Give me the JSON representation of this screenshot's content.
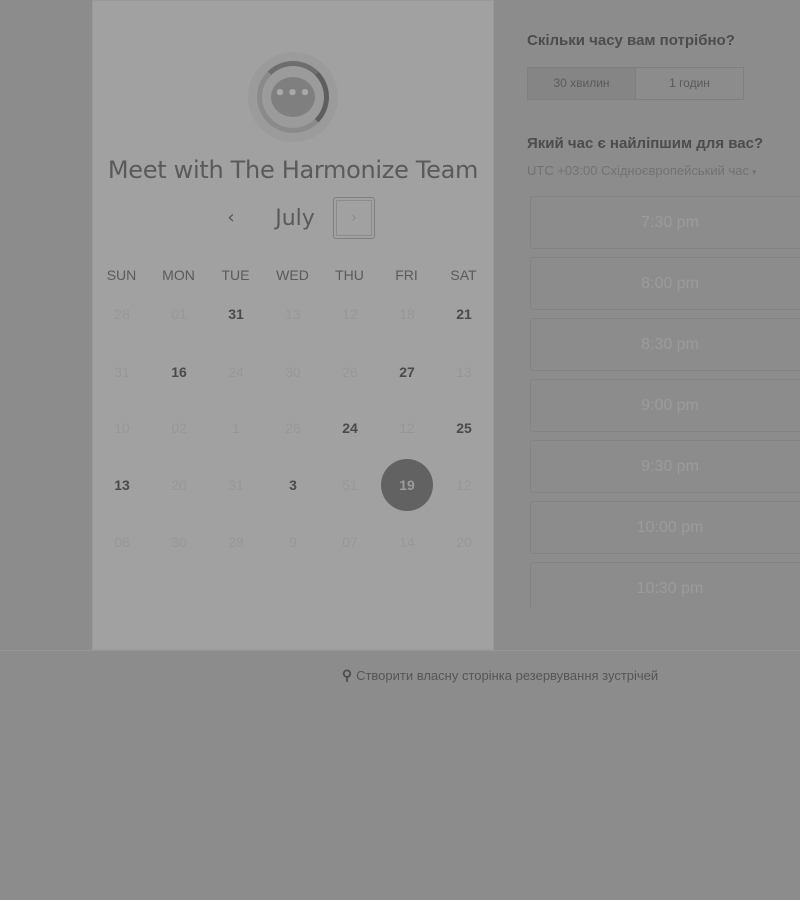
{
  "card": {
    "title": "Meet with The Harmonize Team",
    "logo_icon": "chat-bubble-logo-icon",
    "logo_glyph": "•••",
    "month": "July",
    "prev_glyph": "‹",
    "next_glyph": "›",
    "weekdays": [
      "SUN",
      "MON",
      "TUE",
      "WED",
      "THU",
      "FRI",
      "SAT"
    ],
    "weeks": [
      [
        {
          "label": "28",
          "state": "disabled"
        },
        {
          "label": "01",
          "state": "disabled"
        },
        {
          "label": "31",
          "state": "available"
        },
        {
          "label": "13",
          "state": "disabled"
        },
        {
          "label": "12",
          "state": "disabled"
        },
        {
          "label": "18",
          "state": "disabled"
        },
        {
          "label": "21",
          "state": "available"
        }
      ],
      [
        {
          "label": "31",
          "state": "disabled"
        },
        {
          "label": "16",
          "state": "available"
        },
        {
          "label": "24",
          "state": "disabled"
        },
        {
          "label": "30",
          "state": "disabled"
        },
        {
          "label": "26",
          "state": "disabled"
        },
        {
          "label": "27",
          "state": "available"
        },
        {
          "label": "13",
          "state": "disabled"
        }
      ],
      [
        {
          "label": "10",
          "state": "disabled"
        },
        {
          "label": "02",
          "state": "disabled"
        },
        {
          "label": "1",
          "state": "disabled"
        },
        {
          "label": "26",
          "state": "disabled"
        },
        {
          "label": "24",
          "state": "available"
        },
        {
          "label": "12",
          "state": "disabled"
        },
        {
          "label": "25",
          "state": "available"
        }
      ],
      [
        {
          "label": "13",
          "state": "available"
        },
        {
          "label": "20",
          "state": "disabled"
        },
        {
          "label": "31",
          "state": "disabled"
        },
        {
          "label": "3",
          "state": "available"
        },
        {
          "label": "51",
          "state": "disabled"
        },
        {
          "label": "19",
          "state": "selected"
        },
        {
          "label": "12",
          "state": "disabled"
        }
      ],
      [
        {
          "label": "08",
          "state": "disabled"
        },
        {
          "label": "30",
          "state": "disabled"
        },
        {
          "label": "28",
          "state": "disabled"
        },
        {
          "label": "9",
          "state": "disabled"
        },
        {
          "label": "07",
          "state": "disabled"
        },
        {
          "label": "14",
          "state": "disabled"
        },
        {
          "label": "20",
          "state": "disabled"
        }
      ]
    ]
  },
  "right": {
    "duration_question": "Скільки часу вам потрібно?",
    "duration_options": [
      "30 хвилин",
      "1 годин"
    ],
    "time_question": "Який час є найліпшим для вас?",
    "timezone": "UTC +03:00 Східноєвропейський час",
    "timezone_caret": "▾",
    "slots": [
      "7:30 pm",
      "8:00 pm",
      "8:30 pm",
      "9:00 pm",
      "9:30 pm",
      "10:00 pm",
      "10:30 pm"
    ]
  },
  "footer": {
    "hubspot_icon": "hubspot-icon",
    "hubspot_glyph": "⚲",
    "link_text": "Створити власну сторінка резервування зустрічей"
  },
  "colors": {
    "overlay": "#8c8c8c",
    "card": "#a1a1a1",
    "selected_day": "#626262"
  }
}
